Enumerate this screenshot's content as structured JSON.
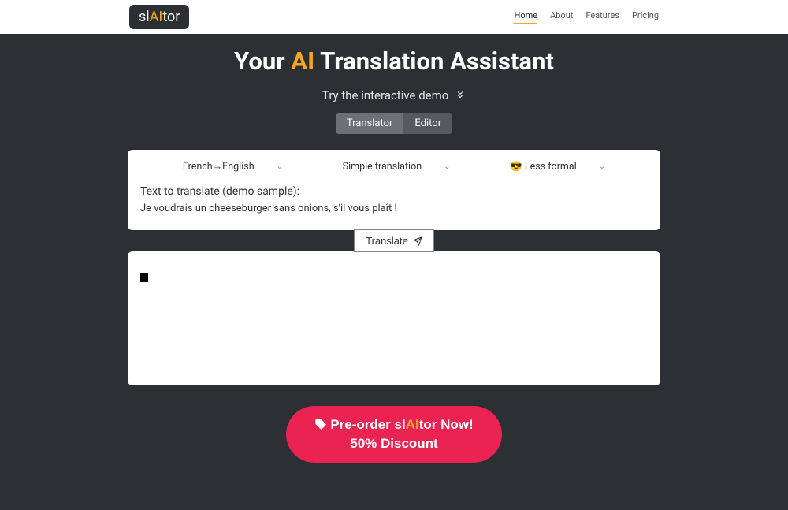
{
  "logo": {
    "pre": "sl",
    "ai": "AI",
    "post": "tor"
  },
  "nav": {
    "home": "Home",
    "about": "About",
    "features": "Features",
    "pricing": "Pricing"
  },
  "hero": {
    "title_pre": "Your ",
    "title_ai": "AI",
    "title_post": " Translation Assistant",
    "demo_text": "Try the interactive demo"
  },
  "tabs": {
    "translator": "Translator",
    "editor": "Editor"
  },
  "selectors": {
    "lang": "French→English",
    "mode": "Simple translation",
    "tone": "😎 Less formal"
  },
  "input": {
    "label": "Text to translate (demo sample):",
    "text": "Je voudrais un cheeseburger sans onions, s'il vous plaît !"
  },
  "translate_btn": "Translate",
  "cta": {
    "line1_pre": "Pre-order sl",
    "line1_ai": "AI",
    "line1_post": "tor Now!",
    "line2": "50% Discount"
  }
}
